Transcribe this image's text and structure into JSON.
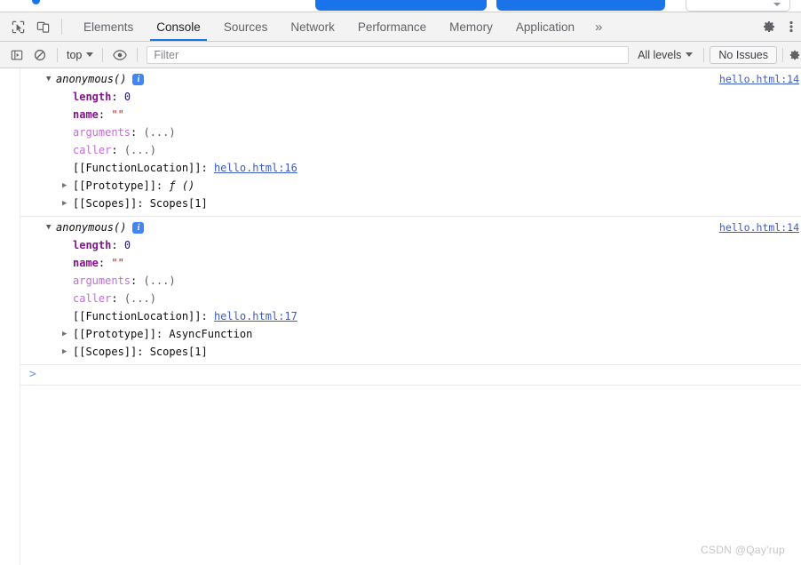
{
  "page_strip": {
    "button_one_label": "",
    "button_two_label": "",
    "field_label": ""
  },
  "devtools": {
    "tabbar": {
      "inspect_icon": "inspect-cursor-icon",
      "device_icon": "device-toolbar-icon",
      "tabs": [
        {
          "label": "Elements",
          "active": false
        },
        {
          "label": "Console",
          "active": true
        },
        {
          "label": "Sources",
          "active": false
        },
        {
          "label": "Network",
          "active": false
        },
        {
          "label": "Performance",
          "active": false
        },
        {
          "label": "Memory",
          "active": false
        },
        {
          "label": "Application",
          "active": false
        }
      ],
      "overflow_label": "»",
      "settings_icon": "gear-icon",
      "menu_icon": "vertical-dots-icon"
    },
    "filterbar": {
      "sidebar_icon": "console-sidebar-icon",
      "clear_icon": "clear-console-icon",
      "context": "top",
      "eye_icon": "live-expression-eye-icon",
      "filter_placeholder": "Filter",
      "filter_value": "",
      "levels_label": "All levels",
      "issues_label": "No Issues"
    },
    "console": {
      "messages": [
        {
          "name": "anonymous()",
          "badge": "i",
          "source": "hello.html:14",
          "properties": [
            {
              "key": "length",
              "key_style": "own",
              "value": "0",
              "value_style": "num",
              "expandable": false
            },
            {
              "key": "name",
              "key_style": "own",
              "value": "\"\"",
              "value_style": "str",
              "expandable": false
            },
            {
              "key": "arguments",
              "key_style": "acc",
              "value": "(...)",
              "value_style": "dim",
              "expandable": false
            },
            {
              "key": "caller",
              "key_style": "acc",
              "value": "(...)",
              "value_style": "dim",
              "expandable": false
            },
            {
              "key": "[[FunctionLocation]]",
              "key_style": "int",
              "value": "hello.html:16",
              "value_style": "link",
              "expandable": false
            },
            {
              "key": "[[Prototype]]",
              "key_style": "int",
              "value": "ƒ ()",
              "value_style": "fn",
              "expandable": true
            },
            {
              "key": "[[Scopes]]",
              "key_style": "int",
              "value": "Scopes[1]",
              "value_style": "plain",
              "expandable": true
            }
          ]
        },
        {
          "name": "anonymous()",
          "badge": "i",
          "source": "hello.html:14",
          "properties": [
            {
              "key": "length",
              "key_style": "own",
              "value": "0",
              "value_style": "num",
              "expandable": false
            },
            {
              "key": "name",
              "key_style": "own",
              "value": "\"\"",
              "value_style": "str",
              "expandable": false
            },
            {
              "key": "arguments",
              "key_style": "acc",
              "value": "(...)",
              "value_style": "dim",
              "expandable": false
            },
            {
              "key": "caller",
              "key_style": "acc",
              "value": "(...)",
              "value_style": "dim",
              "expandable": false
            },
            {
              "key": "[[FunctionLocation]]",
              "key_style": "int",
              "value": "hello.html:17",
              "value_style": "link",
              "expandable": false
            },
            {
              "key": "[[Prototype]]",
              "key_style": "int",
              "value": "AsyncFunction",
              "value_style": "plain",
              "expandable": true
            },
            {
              "key": "[[Scopes]]",
              "key_style": "int",
              "value": "Scopes[1]",
              "value_style": "plain",
              "expandable": true
            }
          ]
        }
      ],
      "prompt_symbol": ">",
      "prompt_value": ""
    }
  },
  "watermark": "CSDN @Qay'rup",
  "colors": {
    "accent_blue": "#1a73e8",
    "link_blue": "#3b5cc4",
    "own_prop_purple": "#881391",
    "accessor_purple": "#c26bd6",
    "number_blue": "#1c00cf",
    "string_red": "#c41a16",
    "toolbar_bg": "#f3f3f3"
  }
}
